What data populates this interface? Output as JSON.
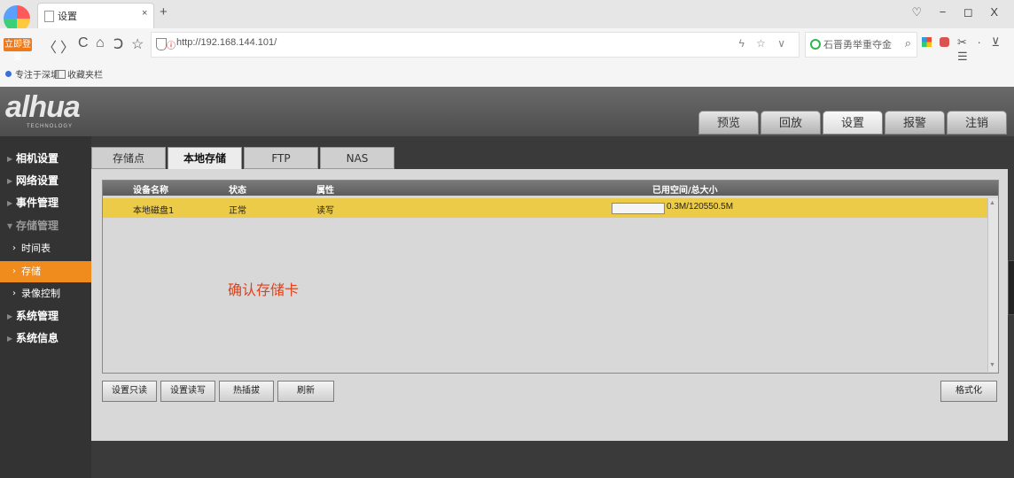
{
  "browser": {
    "tab_title": "设置",
    "tab_close": "×",
    "new_tab": "+",
    "window_controls": "♡ − ◻ X",
    "login_badge": "立即登录",
    "url_prefix": "ⓘ",
    "url": "http://192.168.144.101/",
    "url_actions": "ϟ ☆ ∨",
    "search_placeholder": "石晋勇举重夺金",
    "search_icon": "search-icon",
    "extensions": "✂ · ⊻ ☰",
    "nav": {
      "back": "〈",
      "forward": "〉",
      "reload": "C",
      "home": "⌂",
      "undo": "Ↄ",
      "star": "☆"
    },
    "bookmarks": [
      "专注于深圳",
      "收藏夹栏"
    ]
  },
  "header": {
    "logo": "alhua",
    "logo_sub": "TECHNOLOGY",
    "tabs": [
      {
        "label": "预览"
      },
      {
        "label": "回放"
      },
      {
        "label": "设置"
      },
      {
        "label": "报警"
      },
      {
        "label": "注销"
      }
    ]
  },
  "sidebar": {
    "items": [
      {
        "label": "相机设置"
      },
      {
        "label": "网络设置"
      },
      {
        "label": "事件管理"
      },
      {
        "label": "存储管理"
      },
      {
        "label": "时间表"
      },
      {
        "label": "存储"
      },
      {
        "label": "录像控制"
      },
      {
        "label": "系统管理"
      },
      {
        "label": "系统信息"
      }
    ]
  },
  "content": {
    "subtabs": [
      {
        "label": "存储点"
      },
      {
        "label": "本地存储"
      },
      {
        "label": "FTP"
      },
      {
        "label": "NAS"
      }
    ],
    "table": {
      "headers": [
        "设备名称",
        "状态",
        "属性",
        "已用空间/总大小"
      ],
      "rows": [
        {
          "name": "本地磁盘1",
          "status": "正常",
          "attribute": "读写",
          "capacity": "0.3M/120550.5M",
          "used_fraction": 2e-06
        }
      ]
    },
    "annotation": "确认存储卡",
    "buttons": {
      "set_readonly": "设置只读",
      "set_readwrite": "设置读写",
      "hotplug": "热插拔",
      "refresh": "刷新",
      "format": "格式化"
    }
  },
  "colors": {
    "accent_orange": "#f08c1e",
    "selected_row": "#eccb48",
    "annotation_red": "#e0401a",
    "sidebar_bg": "#333333"
  }
}
